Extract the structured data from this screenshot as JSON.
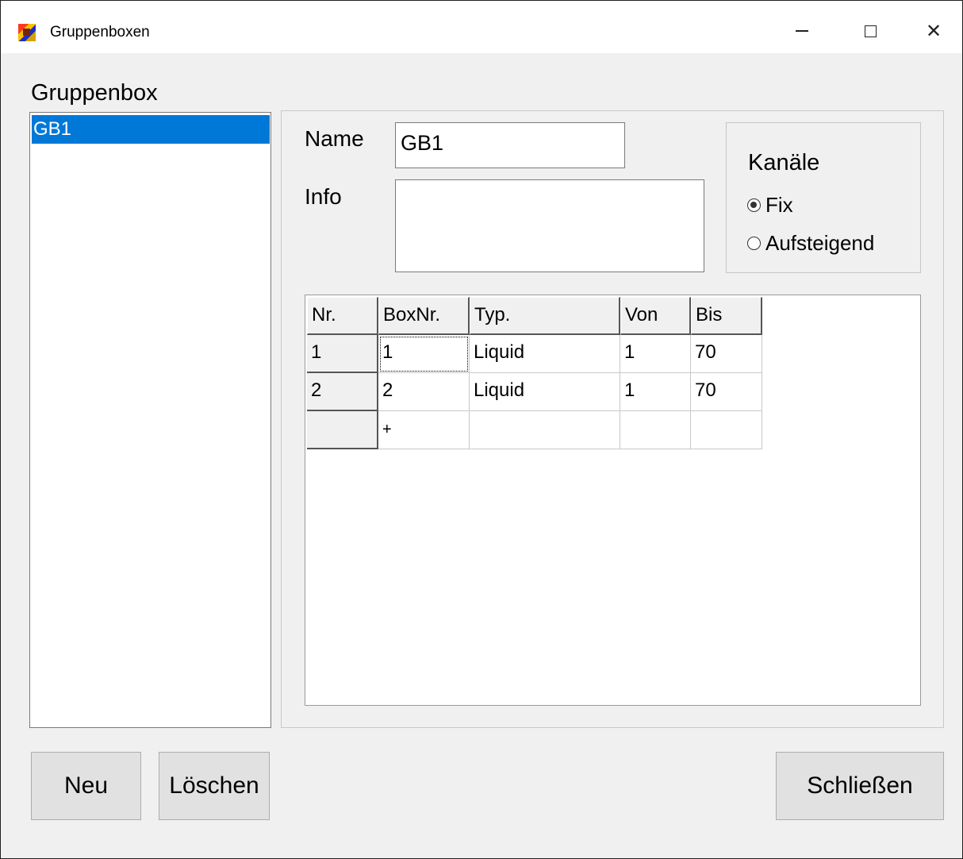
{
  "window": {
    "title": "Gruppenboxen"
  },
  "list": {
    "label": "Gruppenbox",
    "items": [
      "GB1"
    ],
    "selected": "GB1"
  },
  "form": {
    "name_label": "Name",
    "name_value": "GB1",
    "info_label": "Info",
    "info_value": ""
  },
  "channels": {
    "label": "Kanäle",
    "options": [
      {
        "label": "Fix",
        "checked": true
      },
      {
        "label": "Aufsteigend",
        "checked": false
      }
    ]
  },
  "grid": {
    "columns": [
      "Nr.",
      "BoxNr.",
      "Typ.",
      "Von",
      "Bis"
    ],
    "rows": [
      [
        "1",
        "1",
        "Liquid",
        "1",
        "70"
      ],
      [
        "2",
        "2",
        "Liquid",
        "1",
        "70"
      ]
    ],
    "new_row_marker": "+"
  },
  "buttons": {
    "new": "Neu",
    "delete": "Löschen",
    "close": "Schließen"
  }
}
